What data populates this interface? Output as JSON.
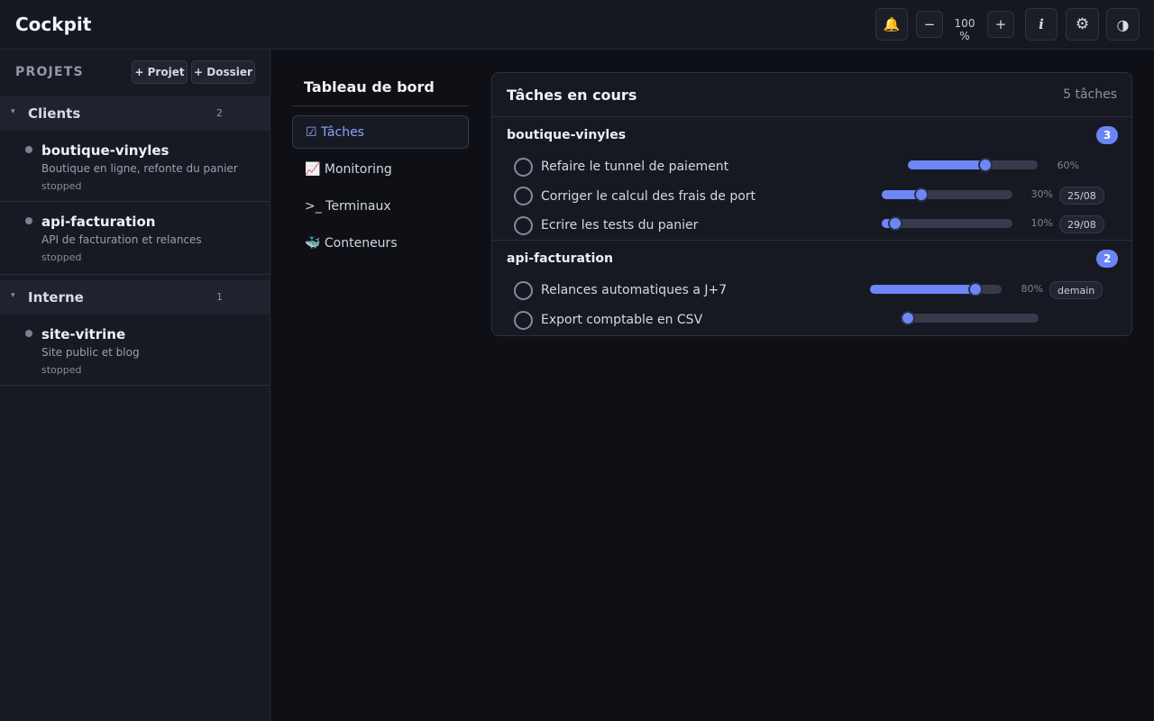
{
  "app": {
    "title": "Cockpit"
  },
  "toolbar": {
    "bell_icon": "🔔",
    "zoom_out": "−",
    "zoom_value": "100 %",
    "zoom_in": "+",
    "info_icon": "i",
    "settings_icon": "⚙",
    "theme_icon": "◑"
  },
  "sidebar": {
    "heading": "PROJETS",
    "add_project": "+ Projet",
    "add_folder": "+ Dossier",
    "groups": [
      {
        "label": "Clients",
        "chevron": "▾",
        "count": "2",
        "projects": [
          {
            "name": "boutique-vinyles",
            "description": "Boutique en ligne, refonte du panier",
            "status": "stopped"
          },
          {
            "name": "api-facturation",
            "description": "API de facturation et relances",
            "status": "stopped"
          }
        ]
      },
      {
        "label": "Interne",
        "chevron": "▾",
        "count": "1",
        "projects": [
          {
            "name": "site-vitrine",
            "description": "Site public et blog",
            "status": "stopped"
          }
        ]
      }
    ]
  },
  "nav": {
    "title": "Tableau de bord",
    "items": [
      {
        "label": "☑ Tâches",
        "active": true
      },
      {
        "label": "📈 Monitoring",
        "active": false
      },
      {
        "label": ">_ Terminaux",
        "active": false
      },
      {
        "label": "🐳 Conteneurs",
        "active": false
      }
    ]
  },
  "panel": {
    "title": "Tâches en cours",
    "count": "5 tâches",
    "sections": [
      {
        "name": "boutique-vinyles",
        "badge": "3",
        "tasks": [
          {
            "label": "Refaire le tunnel de paiement",
            "progress": 0.6,
            "percent": "60%",
            "tag": ""
          },
          {
            "label": "Corriger le calcul des frais de port",
            "progress": 0.3,
            "percent": "30%",
            "tag": "25/08"
          },
          {
            "label": "Ecrire les tests du panier",
            "progress": 0.1,
            "percent": "10%",
            "tag": "29/08"
          }
        ]
      },
      {
        "name": "api-facturation",
        "badge": "2",
        "tasks": [
          {
            "label": "Relances automatiques a J+7",
            "progress": 0.8,
            "percent": "80%",
            "tag": "demain"
          },
          {
            "label": "Export comptable en CSV",
            "progress": 0.0,
            "percent": "",
            "tag": ""
          }
        ]
      }
    ]
  },
  "colors": {
    "accent": "#6e87f7",
    "badge": "#6a85f5",
    "background": "#0f1015"
  }
}
